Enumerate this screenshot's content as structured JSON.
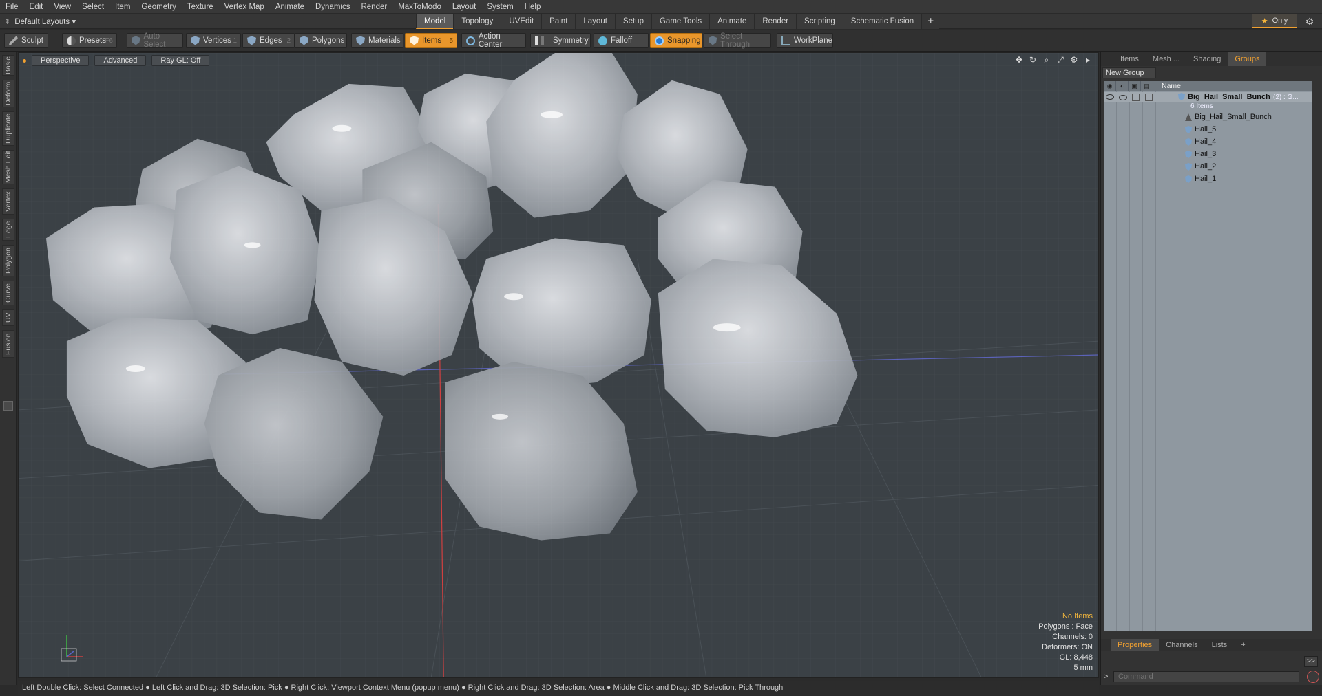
{
  "menu": [
    "File",
    "Edit",
    "View",
    "Select",
    "Item",
    "Geometry",
    "Texture",
    "Vertex Map",
    "Animate",
    "Dynamics",
    "Render",
    "MaxToModo",
    "Layout",
    "System",
    "Help"
  ],
  "layout": {
    "dropdown_label": "Default Layouts ▾",
    "tabs": [
      "Model",
      "Topology",
      "UVEdit",
      "Paint",
      "Layout",
      "Setup",
      "Game Tools",
      "Animate",
      "Render",
      "Scripting",
      "Schematic Fusion"
    ],
    "active_tab": "Model",
    "only_label": "Only"
  },
  "toolbar": {
    "sculpt": "Sculpt",
    "presets": "Presets",
    "presets_key": "F6",
    "auto_select": "Auto Select",
    "vertices": "Vertices",
    "vertices_key": "1",
    "edges": "Edges",
    "edges_key": "2",
    "polygons": "Polygons",
    "materials": "Materials",
    "items": "Items",
    "items_key": "5",
    "action_center": "Action Center",
    "symmetry": "Symmetry",
    "falloff": "Falloff",
    "snapping": "Snapping",
    "select_through": "Select Through",
    "workplane": "WorkPlane"
  },
  "left_tabs": [
    "Basic",
    "Deform",
    "Duplicate",
    "Mesh Edit",
    "Vertex",
    "Edge",
    "Polygon",
    "Curve",
    "UV",
    "Fusion"
  ],
  "viewport": {
    "view_mode": "Perspective",
    "shading": "Advanced",
    "raygl": "Ray GL: Off",
    "info": {
      "selection": "No Items",
      "polygons": "Polygons : Face",
      "channels": "Channels: 0",
      "deformers": "Deformers: ON",
      "gl": "GL: 8,448",
      "grid": "5 mm"
    }
  },
  "right_panel": {
    "tabs": [
      "Items",
      "Mesh ...",
      "Shading",
      "Groups"
    ],
    "active_tab": "Groups",
    "new_group": "New Group",
    "name_header": "Name",
    "group": {
      "name": "Big_Hail_Small_Bunch",
      "suffix": "(2) : G...",
      "count": "6 Items"
    },
    "items": [
      "Big_Hail_Small_Bunch",
      "Hail_5",
      "Hail_4",
      "Hail_3",
      "Hail_2",
      "Hail_1"
    ],
    "bottom_tabs": [
      "Properties",
      "Channels",
      "Lists"
    ],
    "bottom_active": "Properties",
    "command_placeholder": "Command",
    "expand_label": ">>"
  },
  "status_bar": "Left Double Click: Select Connected ● Left Click and Drag: 3D Selection: Pick ● Right Click: Viewport Context Menu (popup menu) ● Right Click and Drag: 3D Selection: Area ● Middle Click and Drag: 3D Selection: Pick Through",
  "colors": {
    "accent": "#f0a030",
    "viewport_bg": "#3b4146",
    "panel_list_bg": "#8f98a0"
  }
}
